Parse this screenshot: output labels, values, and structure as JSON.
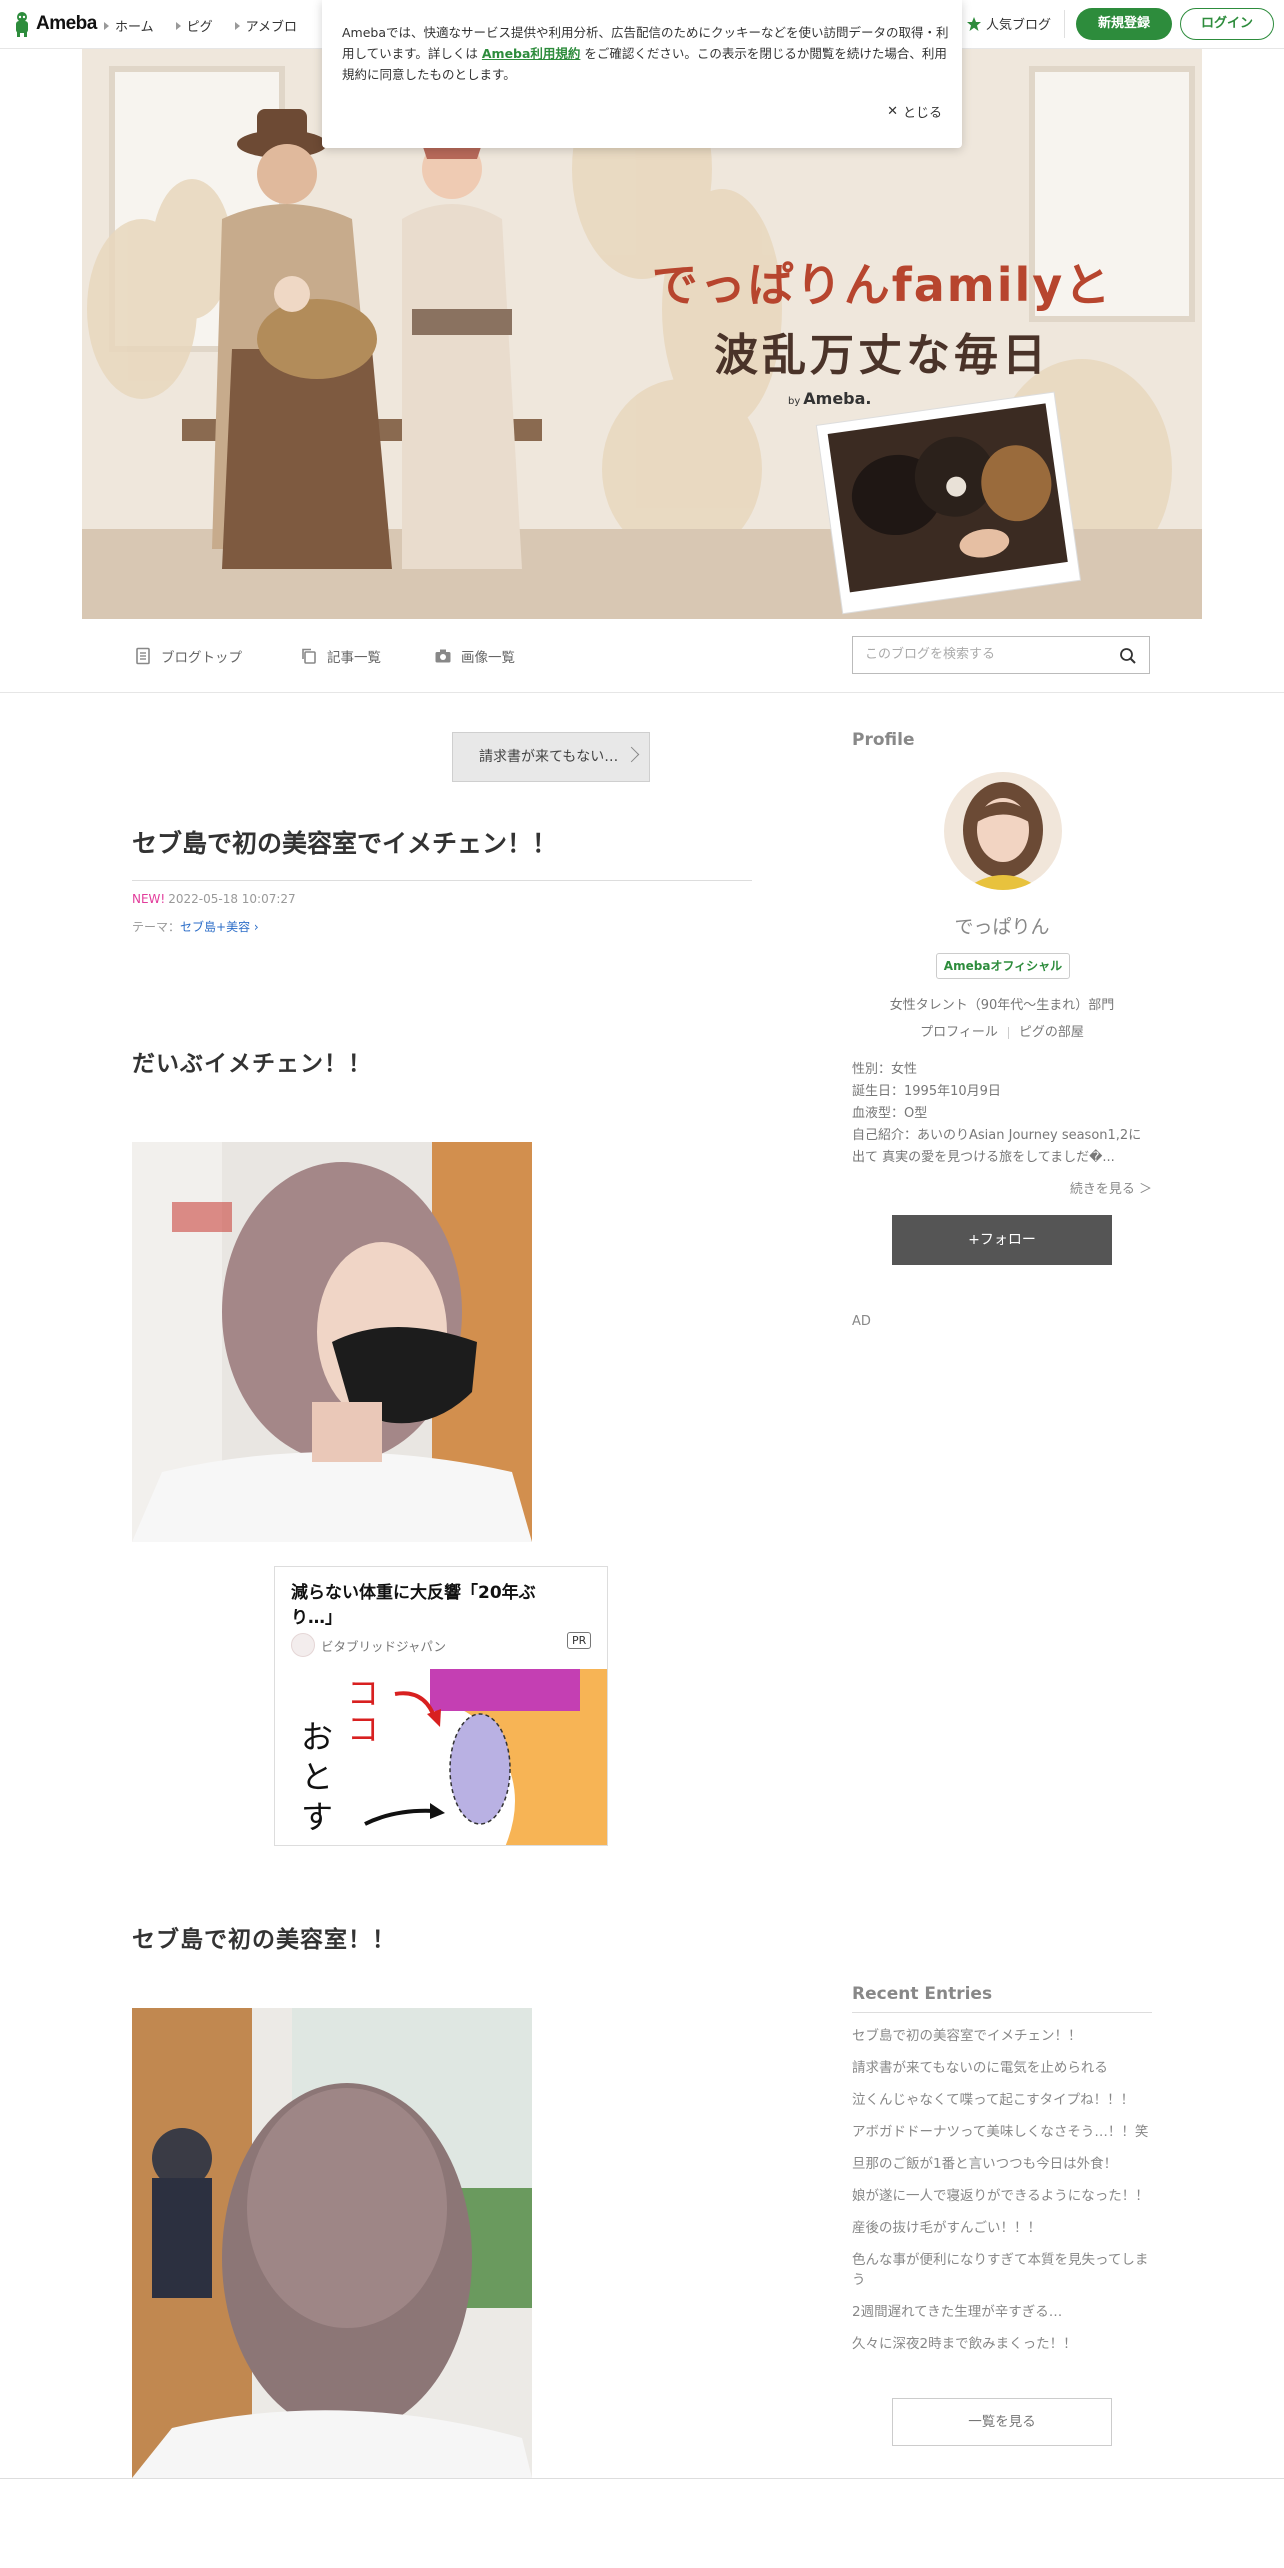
{
  "global": {
    "logo_text": "Ameba",
    "nav": [
      "ホーム",
      "ピグ",
      "アメブロ"
    ],
    "popular": "人気ブログ",
    "signup": "新規登録",
    "login": "ログイン"
  },
  "cookie": {
    "text_before": "Amebaでは、快適なサービス提供や利用分析、広告配信のためにクッキーなどを使い訪問データの取得・利用しています。詳しくは",
    "link": "Ameba利用規約",
    "text_after": "をご確認ください。この表示を閉じるか閲覧を続けた場合、利用規約に同意したものとします。",
    "close": "とじる"
  },
  "banner": {
    "title_line1": "でっぱりんfamilyと",
    "title_line2": "波乱万丈な毎日",
    "by": "by",
    "brand": "Ameba."
  },
  "blognav": {
    "top": "ブログトップ",
    "entries": "記事一覧",
    "images": "画像一覧",
    "search_placeholder": "このブログを検索する"
  },
  "article": {
    "prev_label": "請求書が来てもない…",
    "title": "セブ島で初の美容室でイメチェン！！",
    "new_label": "NEW!",
    "date": "2022-05-18 10:07:27",
    "theme_label": "テーマ：",
    "theme": "セブ島+美容",
    "heading1": "だいぶイメチェン！！",
    "heading2": "セブ島で初の美容室！！"
  },
  "ad": {
    "title": "減らない体重に大反響「20年ぶり…」",
    "source": "ビタブリッドジャパン",
    "pr": "PR",
    "img_text_red": "ココ",
    "img_text_black": "おとす"
  },
  "sidebar": {
    "profile_heading": "Profile",
    "name": "でっぱりん",
    "badge": "Amebaオフィシャル",
    "category": "女性タレント（90年代～生まれ）部門",
    "link_profile": "プロフィール",
    "link_room": "ピグの部屋",
    "info": [
      "性別：女性",
      "誕生日：1995年10月9日",
      "血液型：O型",
      "自己紹介：あいのりAsian Journey season1,2に出て 真実の愛を見つける旅をしてましだ�..."
    ],
    "more": "続きを見る ＞",
    "follow": "+フォロー",
    "ad_label": "AD",
    "recent_heading": "Recent Entries",
    "recent": [
      "セブ島で初の美容室でイメチェン！！",
      "請求書が来てもないのに電気を止められる",
      "泣くんじゃなくて喋って起こすタイプね！！！",
      "アボガドドーナツって美味しくなさそう…！！笑",
      "旦那のご飯が1番と言いつつも今日は外食！",
      "娘が遂に一人で寝返りができるようになった！！",
      "産後の抜け毛がすんごい！！！",
      "色んな事が便利になりすぎて本質を見失ってしまう",
      "2週間遅れてきた生理が辛すぎる…",
      "久々に深夜2時まで飲みまくった！！"
    ],
    "see_all": "一覧を見る"
  }
}
